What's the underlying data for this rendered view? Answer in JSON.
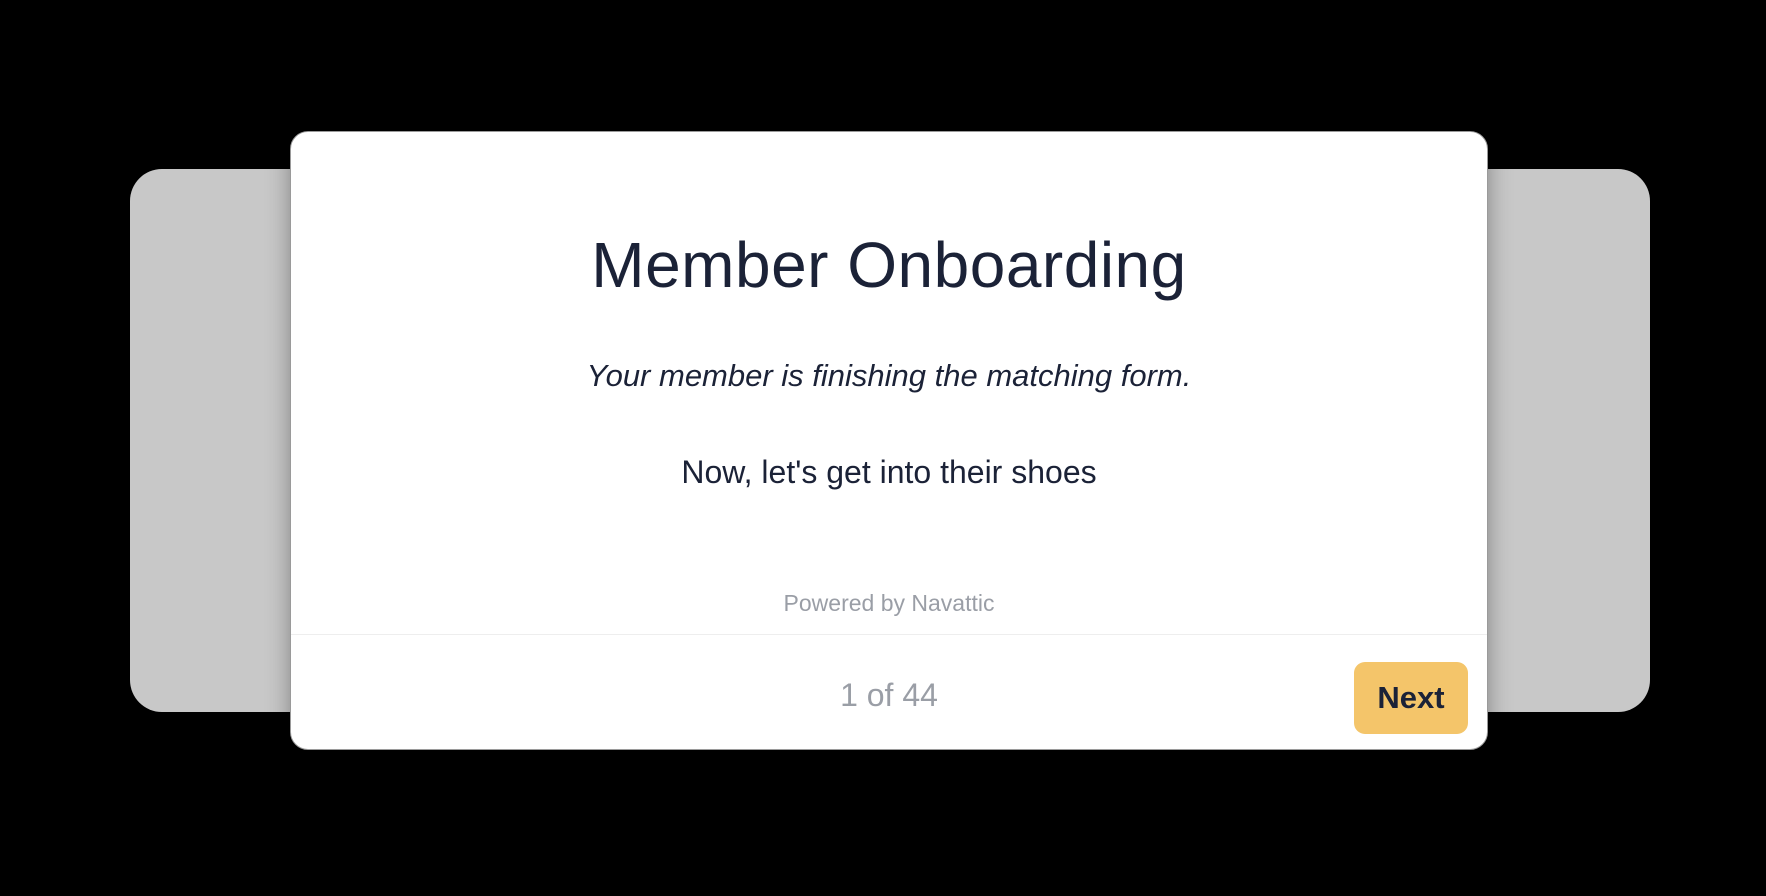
{
  "modal": {
    "title": "Member Onboarding",
    "subtitle": "Your member is finishing the matching form.",
    "body": "Now, let's get into their shoes",
    "powered_by": "Powered by Navattic"
  },
  "footer": {
    "step_counter": "1 of 44",
    "next_label": "Next"
  },
  "colors": {
    "background": "#000000",
    "back_card": "#c8c8c8",
    "modal": "#ffffff",
    "text": "#1b2237",
    "muted_text": "#9a9ea6",
    "accent": "#f4c56a"
  }
}
